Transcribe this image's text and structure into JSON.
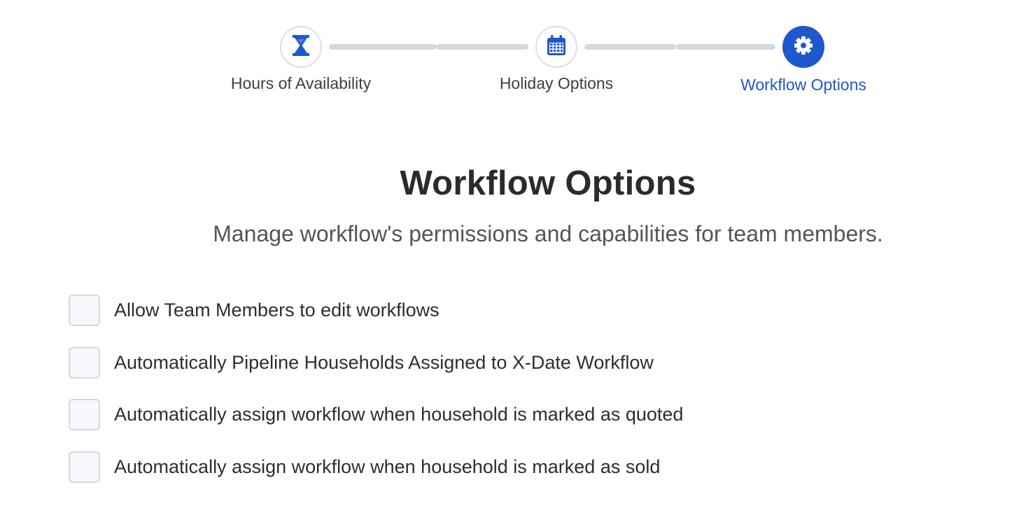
{
  "stepper": {
    "steps": [
      {
        "label": "Hours of Availability",
        "icon": "hourglass-icon",
        "state": "inactive"
      },
      {
        "label": "Holiday Options",
        "icon": "calendar-icon",
        "state": "inactive"
      },
      {
        "label": "Workflow Options",
        "icon": "gear-icon",
        "state": "active"
      }
    ]
  },
  "main": {
    "title": "Workflow Options",
    "subtitle": "Manage workflow's permissions and capabilities for team members."
  },
  "options": [
    {
      "label": "Allow Team Members to edit workflows",
      "checked": false
    },
    {
      "label": "Automatically Pipeline Households Assigned to X-Date Workflow",
      "checked": false
    },
    {
      "label": "Automatically assign workflow when household is marked as quoted",
      "checked": false
    },
    {
      "label": "Automatically assign workflow when household is marked as sold",
      "checked": false
    }
  ],
  "colors": {
    "accent": "#1f57cc",
    "connector": "#d3d8e0",
    "text": "#333333",
    "checkbox_border": "#d4d8df",
    "checkbox_fill": "#f6f8fc"
  }
}
